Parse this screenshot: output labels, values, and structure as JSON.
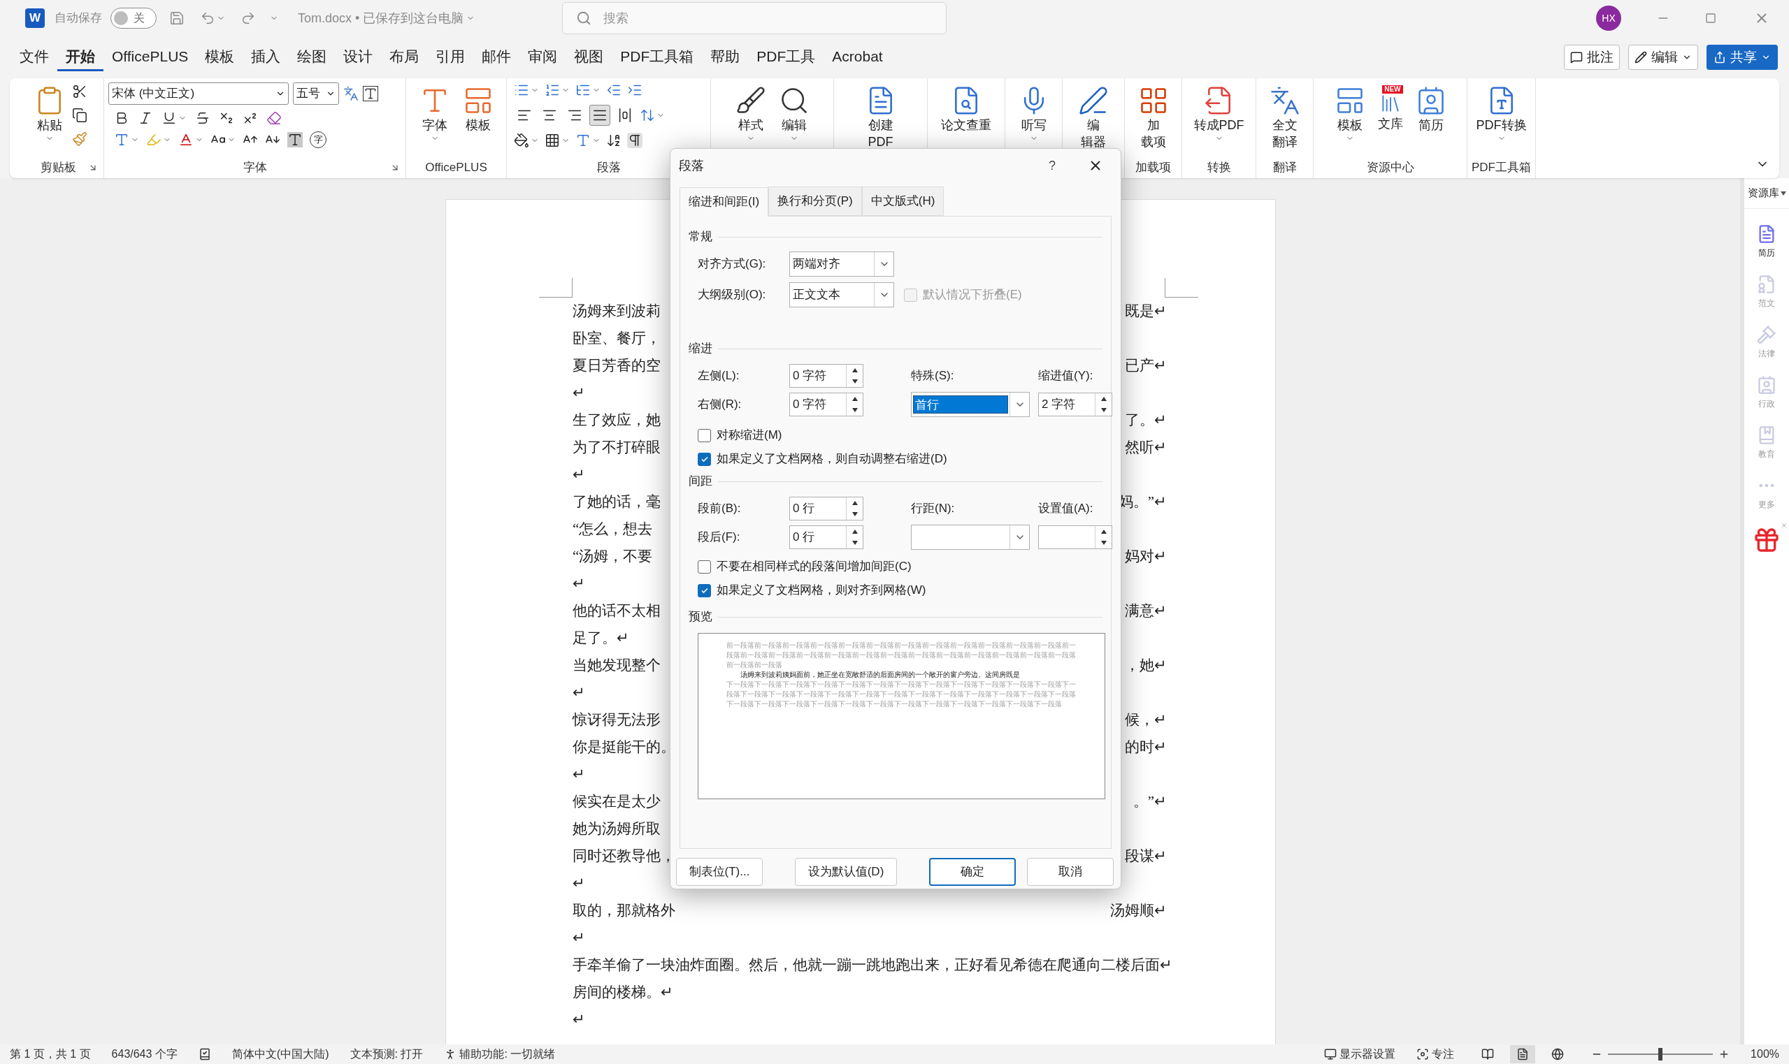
{
  "title_bar": {
    "app_letter": "W",
    "autosave_label": "自动保存",
    "autosave": {
      "on": false,
      "text": "关"
    },
    "document_title": "Tom.docx • 已保存到这台电脑",
    "search": {
      "placeholder": "搜索"
    },
    "avatar": "HX"
  },
  "menu_tabs": [
    {
      "label": "文件",
      "selected": false
    },
    {
      "label": "开始",
      "selected": true
    },
    {
      "label": "OfficePLUS",
      "selected": false
    },
    {
      "label": "模板",
      "selected": false
    },
    {
      "label": "插入",
      "selected": false
    },
    {
      "label": "绘图",
      "selected": false
    },
    {
      "label": "设计",
      "selected": false
    },
    {
      "label": "布局",
      "selected": false
    },
    {
      "label": "引用",
      "selected": false
    },
    {
      "label": "邮件",
      "selected": false
    },
    {
      "label": "审阅",
      "selected": false
    },
    {
      "label": "视图",
      "selected": false
    },
    {
      "label": "PDF工具箱",
      "selected": false
    },
    {
      "label": "帮助",
      "selected": false
    },
    {
      "label": "PDF工具",
      "selected": false
    },
    {
      "label": "Acrobat",
      "selected": false
    }
  ],
  "menu_actions": [
    {
      "kind": "comment",
      "label": "批注"
    },
    {
      "kind": "editing",
      "label": "编辑"
    },
    {
      "kind": "share",
      "label": "共享"
    }
  ],
  "ribbon": {
    "groups": [
      {
        "kind": "clipboard",
        "label": "剪贴板",
        "buttons": [
          {
            "kind": "paste",
            "lines": [
              "粘贴"
            ],
            "dropdown": true
          }
        ]
      },
      {
        "kind": "font",
        "label": "字体",
        "font_name": "宋体 (中文正文)",
        "font_size": "五号",
        "enclose_char": "字"
      },
      {
        "kind": "buttons",
        "label": "OfficePLUS",
        "buttons": [
          {
            "kind": "font_style",
            "lines": [
              "字体"
            ],
            "dropdown": true
          },
          {
            "kind": "template_plus",
            "lines": [
              "模板"
            ],
            "dropdown": false
          }
        ]
      },
      {
        "kind": "paragraph",
        "label": "段落",
        "alignments": [
          {
            "kind": "left",
            "selected": false
          },
          {
            "kind": "center",
            "selected": false
          },
          {
            "kind": "right",
            "selected": false
          },
          {
            "kind": "justify",
            "selected": true
          },
          {
            "kind": "distributed",
            "selected": false
          }
        ]
      },
      {
        "kind": "buttons",
        "buttons": [
          {
            "kind": "styles",
            "lines": [
              "样式"
            ],
            "dropdown": true
          },
          {
            "kind": "editing",
            "lines": [
              "编辑"
            ],
            "dropdown": true
          }
        ]
      },
      {
        "kind": "buttons",
        "buttons": [
          {
            "kind": "create_pdf",
            "lines": [
              "创建",
              "PDF"
            ],
            "dropdown": false
          }
        ]
      },
      {
        "kind": "buttons",
        "buttons": [
          {
            "kind": "plagiarism",
            "lines": [
              "论文查重"
            ],
            "dropdown": false
          }
        ]
      },
      {
        "kind": "buttons",
        "buttons": [
          {
            "kind": "dictate",
            "lines": [
              "听写"
            ],
            "dropdown": true
          }
        ]
      },
      {
        "kind": "buttons",
        "buttons": [
          {
            "kind": "editor",
            "lines": [
              "编",
              "辑器"
            ],
            "dropdown": false
          }
        ]
      },
      {
        "kind": "buttons",
        "label": "加载项",
        "buttons": [
          {
            "kind": "addins",
            "lines": [
              "加",
              "载项"
            ],
            "dropdown": false
          }
        ]
      },
      {
        "kind": "buttons",
        "label": "转换",
        "buttons": [
          {
            "kind": "to_pdf",
            "lines": [
              "转成PDF"
            ],
            "dropdown": true
          }
        ]
      },
      {
        "kind": "buttons",
        "label": "翻译",
        "buttons": [
          {
            "kind": "translate",
            "lines": [
              "全文",
              "翻译"
            ],
            "dropdown": false
          }
        ]
      },
      {
        "kind": "buttons",
        "label": "资源中心",
        "buttons": [
          {
            "kind": "templates",
            "lines": [
              "模板"
            ],
            "dropdown": true
          },
          {
            "kind": "library",
            "lines": [
              "文库"
            ],
            "dropdown": false,
            "badge": "NEW"
          },
          {
            "kind": "resume",
            "lines": [
              "简历"
            ],
            "dropdown": false
          }
        ]
      },
      {
        "kind": "buttons",
        "label": "PDF工具箱",
        "buttons": [
          {
            "kind": "pdf_convert",
            "lines": [
              "PDF转换"
            ],
            "dropdown": true
          }
        ]
      }
    ]
  },
  "document": {
    "lines": [
      {
        "left": "汤姆来到波莉",
        "right": "既是↵"
      },
      {
        "left": "卧室、餐厅，"
      },
      {
        "left": "夏日芳香的空",
        "right": "已产↵"
      },
      {
        "left": "↵"
      },
      {
        "left": "生了效应，她",
        "right": "了。↵"
      },
      {
        "left": "为了不打碎眼",
        "right": "然听↵"
      },
      {
        "left": "↵"
      },
      {
        "left": "了她的话，毫",
        "right": "妈。”↵"
      },
      {
        "left": "“怎么，想去"
      },
      {
        "left": "“汤姆，不要",
        "right": "妈对↵"
      },
      {
        "left": "↵"
      },
      {
        "left": "他的话不太相",
        "right": "满意↵"
      },
      {
        "left": "足了。↵"
      },
      {
        "left": "当她发现整个",
        "right": "，她↵"
      },
      {
        "left": "↵"
      },
      {
        "left": "惊讶得无法形",
        "right": "候，↵"
      },
      {
        "left": "你是挺能干的。",
        "right": "的时↵"
      },
      {
        "left": "↵"
      },
      {
        "left": "候实在是太少",
        "right": "。”↵"
      },
      {
        "left": "她为汤姆所取"
      },
      {
        "left": "同时还教导他，",
        "right": "段谋↵"
      },
      {
        "left": "↵"
      },
      {
        "left": "取的，那就格外",
        "right": "汤姆顺↵"
      },
      {
        "left": "↵"
      },
      {
        "left": "手牵羊偷了一块油炸面圈。然后，他就一蹦一跳地跑出来，正好看见希德在爬通向二楼后面↵"
      },
      {
        "left": "房间的楼梯。↵"
      },
      {
        "left": "↵"
      }
    ]
  },
  "dialog": {
    "title": "段落",
    "help": "?",
    "tabs": [
      {
        "label": "缩进和间距(I)",
        "selected": true
      },
      {
        "label": "换行和分页(P)",
        "selected": false
      },
      {
        "label": "中文版式(H)",
        "selected": false
      }
    ],
    "general": {
      "heading": "常规",
      "alignment": {
        "label": "对齐方式(G):",
        "value": "两端对齐"
      },
      "outline": {
        "label": "大纲级别(O):",
        "value": "正文文本"
      },
      "collapse": {
        "label": "默认情况下折叠(E)",
        "checked": false,
        "disabled": true
      }
    },
    "indent": {
      "heading": "缩进",
      "left": {
        "label": "左侧(L):",
        "value": "0 字符"
      },
      "right": {
        "label": "右侧(R):",
        "value": "0 字符"
      },
      "special": {
        "label": "特殊(S):",
        "value": "首行"
      },
      "by": {
        "label": "缩进值(Y):",
        "value": "2 字符"
      },
      "checks": [
        {
          "label": "对称缩进(M)",
          "checked": false
        },
        {
          "label": "如果定义了文档网格，则自动调整右缩进(D)",
          "checked": true
        }
      ]
    },
    "spacing": {
      "heading": "间距",
      "before": {
        "label": "段前(B):",
        "value": "0 行"
      },
      "after": {
        "label": "段后(F):",
        "value": "0 行"
      },
      "line_spacing": {
        "label": "行距(N):"
      },
      "at": {
        "label": "设置值(A):"
      },
      "checks": [
        {
          "label": "不要在相同样式的段落间增加间距(C)",
          "checked": false
        },
        {
          "label": "如果定义了文档网格，则对齐到网格(W)",
          "checked": true
        }
      ]
    },
    "preview": {
      "heading": "预览",
      "before": "前一段落前一段落前一段落前一段落前一段落前一段落前一段落前一段落前一段落前一段落前一段落前一段落前一段落前一段落前一段落前一段落前一段落前一段落前一段落前一段落前一段落前一段落前一段落前一段落前一段落前一段落前一段落",
      "sample": "汤姆来到波莉姨妈面前，她正坐在宽敞舒适的后面房间的一个敞开的窗户旁边。这间房既是",
      "after": "下一段落下一段落下一段落下一段落下一段落下一段落下一段落下一段落下一段落下一段落下一段落下一段落下一段落下一段落下一段落下一段落下一段落下一段落下一段落下一段落下一段落下一段落下一段落下一段落下一段落下一段落下一段落下一段落下一段落下一段落下一段落下一段落下一段落下一段落下一段落下一段落下一段落"
    },
    "buttons": [
      {
        "label": "制表位(T)...",
        "default": false
      },
      {
        "label": "设为默认值(D)",
        "default": false
      },
      {
        "label": "确定",
        "default": true
      },
      {
        "label": "取消",
        "default": false
      }
    ]
  },
  "side_panel": {
    "title": "资源库",
    "items": [
      {
        "kind": "resume",
        "label": "简历",
        "selected": true
      },
      {
        "kind": "essay",
        "label": "范文",
        "selected": false
      },
      {
        "kind": "law",
        "label": "法律",
        "selected": false
      },
      {
        "kind": "admin",
        "label": "行政",
        "selected": false
      },
      {
        "kind": "education",
        "label": "教育",
        "selected": false
      },
      {
        "kind": "more",
        "label": "更多",
        "selected": false
      }
    ]
  },
  "status_bar": {
    "left": [
      {
        "kind": "text",
        "text": "第 1 页，共 1 页"
      },
      {
        "kind": "text",
        "text": "643/643 个字"
      },
      {
        "kind": "proofing"
      },
      {
        "kind": "text",
        "text": "简体中文(中国大陆)"
      },
      {
        "kind": "text",
        "text": "文本预测: 打开"
      },
      {
        "kind": "accessibility",
        "text": "辅助功能: 一切就绪"
      }
    ],
    "display": "显示器设置",
    "focus": "专注",
    "views": [
      {
        "kind": "read",
        "selected": false
      },
      {
        "kind": "print",
        "selected": true
      },
      {
        "kind": "web",
        "selected": false
      }
    ],
    "zoom": {
      "level": 0.5,
      "text": "100%"
    }
  }
}
